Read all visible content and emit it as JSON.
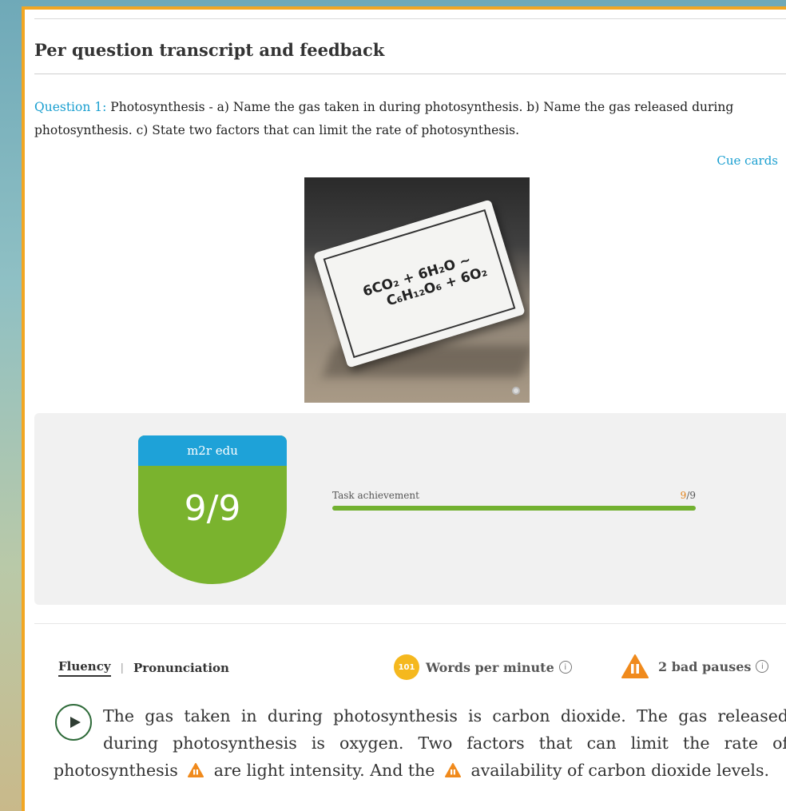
{
  "section": {
    "title": "Per question transcript and feedback"
  },
  "question": {
    "label": "Question 1:",
    "text": "Photosynthesis - a) Name the gas taken in during photosynthesis. b) Name the gas released during photosynthesis. c) State two factors that can limit the rate of photosynthesis."
  },
  "cue_cards": {
    "link_label": "Cue cards",
    "card_line1": "6CO₂ + 6H₂O ~",
    "card_line2": "C₆H₁₂O₆ + 6O₂"
  },
  "score": {
    "brand": "m2r edu",
    "value": "9/9",
    "metrics": [
      {
        "label": "Task achievement",
        "score": "9",
        "max": "/9",
        "fraction": 1.0
      }
    ]
  },
  "fluency": {
    "tabs": [
      "Fluency",
      "Pronunciation"
    ],
    "tab_separator": "|",
    "wpm_value": "101",
    "wpm_label": "Words per minute",
    "bad_pauses_label": "2 bad pauses",
    "info_glyph": "i"
  },
  "transcript": {
    "part1": "The gas taken in during photosynthesis is carbon dioxide. The gas released during photosynthesis is oxygen. Two factors that can limit the rate of photosynthesis",
    "part2": "are light intensity. And the",
    "part3": "availability of carbon dioxide levels."
  },
  "colors": {
    "accent_blue": "#1a9fd0",
    "frame_orange": "#f2a622",
    "score_green": "#7ab32e",
    "warning_orange": "#f08a1c",
    "wpm_yellow": "#f5b81e"
  }
}
